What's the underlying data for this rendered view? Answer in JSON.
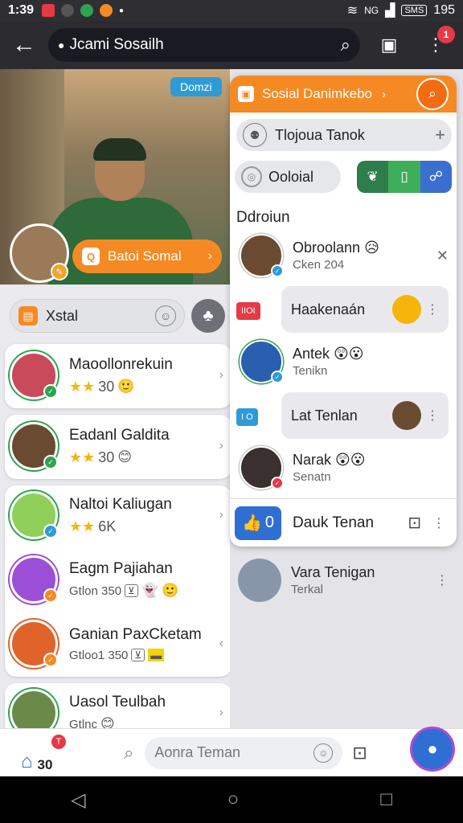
{
  "status": {
    "time": "1:39",
    "network": "NG",
    "battery": "SMS",
    "level": "195"
  },
  "appbar": {
    "back_icon": "←",
    "search_text": "Jcami Sosailh",
    "search_icon": "⌕",
    "notif_count": "1"
  },
  "hero": {
    "tag": "Domzi",
    "button": "Batoi Somal"
  },
  "filter": {
    "label": "Xstal"
  },
  "friends": [
    {
      "name": "Maoollonrekuin",
      "score": "30"
    },
    {
      "name": "Eadanl Galdita",
      "score": "30"
    },
    {
      "name": "Naltoi Kaliugan",
      "score": "6K"
    },
    {
      "name": "Eagm Pajiahan",
      "meta": "Gtlon 350"
    },
    {
      "name": "Ganian PaxCketam",
      "meta": "Gtloo1 350"
    },
    {
      "name": "Uasol Teulbah",
      "meta": "Gtlnc"
    }
  ],
  "panel": {
    "title": "Sosial Danimkebo",
    "search": "Tlojoua Tanok",
    "toggle": "Ooloial",
    "section": "Ddroiun",
    "rows": [
      {
        "name": "Obroolann",
        "sub": "Cken 204"
      },
      {
        "name": "Haakenaán",
        "tag": "IIOI"
      },
      {
        "name": "Antek",
        "sub": "Tenikn"
      },
      {
        "name": "Lat Tenlan",
        "tag": "I O"
      },
      {
        "name": "Narak",
        "sub": "Senatn"
      }
    ],
    "footer": {
      "like_count": "0",
      "label": "Dauk Tenan"
    }
  },
  "below": {
    "name": "Vara Tenigan",
    "sub": "Terkal"
  },
  "bottom": {
    "count": "30",
    "badge": "T",
    "placeholder": "Aonra Teman"
  }
}
